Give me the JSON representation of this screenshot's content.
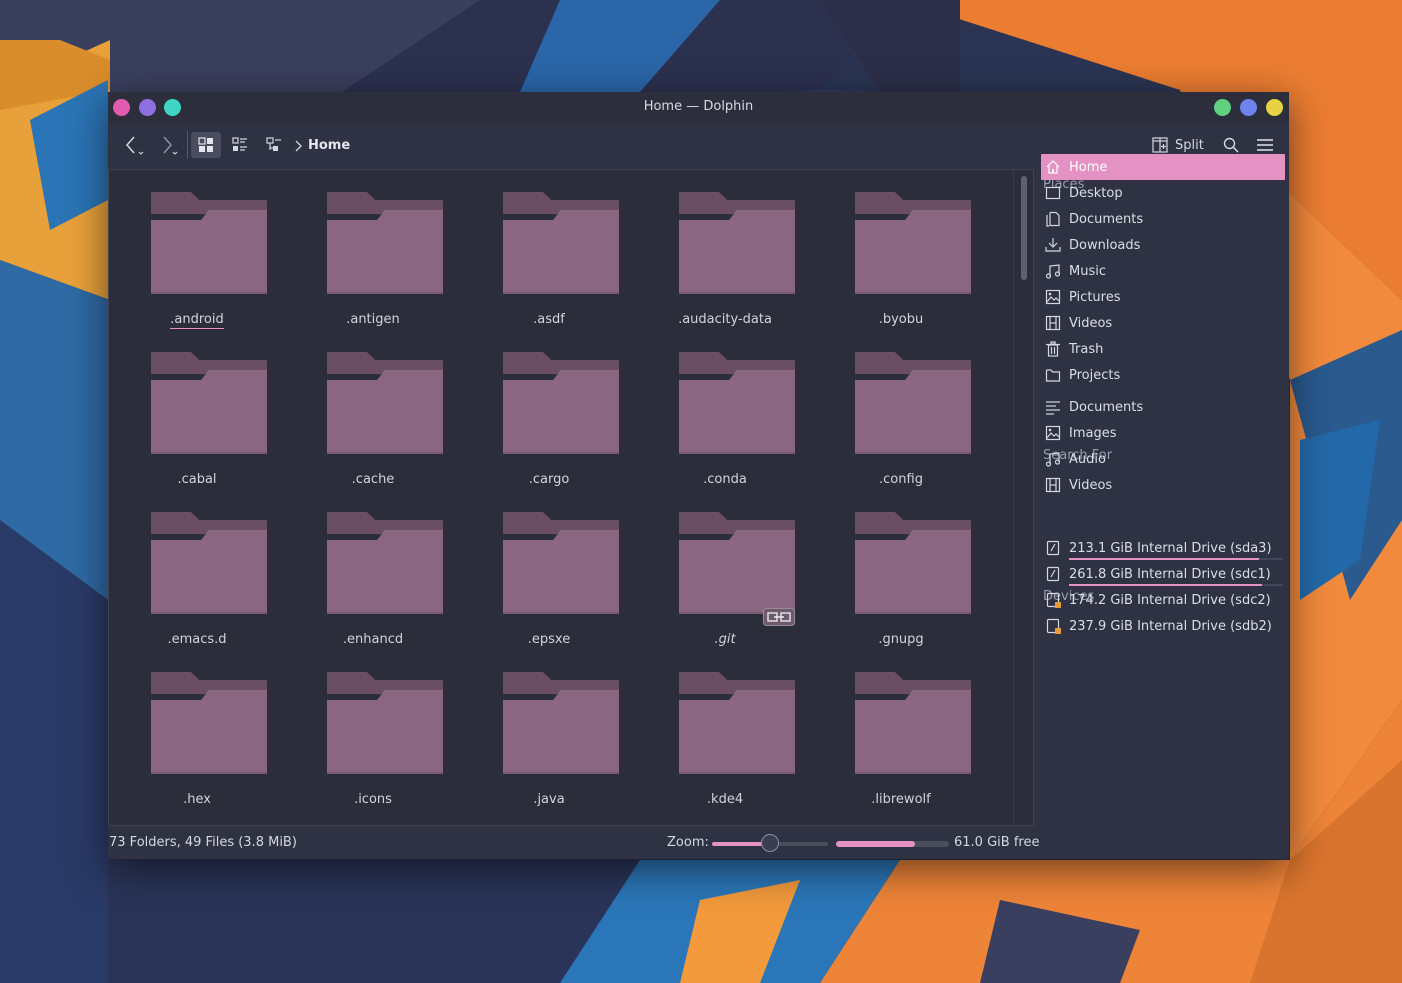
{
  "window": {
    "title": "Home — Dolphin",
    "left_dots": [
      "#e15bae",
      "#8f6fe0",
      "#3fd4c5"
    ],
    "right_dots": [
      "#5fd07f",
      "#6f83ef",
      "#e6d343"
    ]
  },
  "toolbar": {
    "breadcrumb": "Home",
    "split_label": "Split"
  },
  "files": [
    {
      "name": ".android",
      "underlined": true
    },
    {
      "name": ".antigen"
    },
    {
      "name": ".asdf"
    },
    {
      "name": ".audacity-data"
    },
    {
      "name": ".byobu"
    },
    {
      "name": ".cabal"
    },
    {
      "name": ".cache"
    },
    {
      "name": ".cargo"
    },
    {
      "name": ".conda"
    },
    {
      "name": ".config"
    },
    {
      "name": ".emacs.d"
    },
    {
      "name": ".enhancd"
    },
    {
      "name": ".epsxe"
    },
    {
      "name": ".git",
      "italic": true,
      "emblem": "symlink-icon"
    },
    {
      "name": ".gnupg"
    },
    {
      "name": ".hex"
    },
    {
      "name": ".icons"
    },
    {
      "name": ".java"
    },
    {
      "name": ".kde4"
    },
    {
      "name": ".librewolf"
    }
  ],
  "places": {
    "title": "Places",
    "items": [
      {
        "label": "Home",
        "icon": "home-icon",
        "active": true
      },
      {
        "label": "Desktop",
        "icon": "desktop-icon"
      },
      {
        "label": "Documents",
        "icon": "documents-icon"
      },
      {
        "label": "Downloads",
        "icon": "downloads-icon"
      },
      {
        "label": "Music",
        "icon": "music-icon"
      },
      {
        "label": "Pictures",
        "icon": "pictures-icon"
      },
      {
        "label": "Videos",
        "icon": "videos-icon"
      },
      {
        "label": "Trash",
        "icon": "trash-icon"
      },
      {
        "label": "Projects",
        "icon": "folder-icon"
      }
    ]
  },
  "search_for": {
    "title": "Search For",
    "items": [
      {
        "label": "Documents",
        "icon": "text-document-icon"
      },
      {
        "label": "Images",
        "icon": "image-icon"
      },
      {
        "label": "Audio",
        "icon": "audio-icon"
      },
      {
        "label": "Videos",
        "icon": "video-icon"
      }
    ]
  },
  "devices": {
    "title": "Devices",
    "items": [
      {
        "label": "213.1 GiB Internal Drive (sda3)",
        "icon": "drive-icon",
        "usage": 0.89
      },
      {
        "label": "261.8 GiB Internal Drive (sdc1)",
        "icon": "drive-icon",
        "usage": 0.9
      },
      {
        "label": "174.2 GiB Internal Drive (sdc2)",
        "icon": "drive-unmounted-icon"
      },
      {
        "label": "237.9 GiB Internal Drive (sdb2)",
        "icon": "drive-unmounted-icon"
      }
    ]
  },
  "status": {
    "summary": "73 Folders, 49 Files (3.8 MiB)",
    "zoom_label": "Zoom:",
    "zoom_level": 0.5,
    "free_space": "61.0 GiB free",
    "used_fraction": 0.7
  },
  "colors": {
    "accent": "#e491c3",
    "folder_body": "#8a6680",
    "folder_tab": "#6a4e64"
  }
}
